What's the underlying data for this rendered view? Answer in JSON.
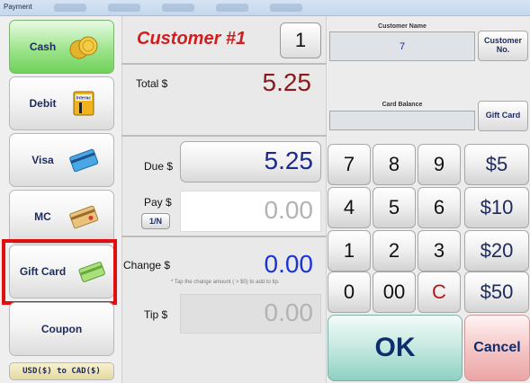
{
  "window": {
    "title": "Payment"
  },
  "payment_methods": {
    "cash": "Cash",
    "debit": "Debit",
    "debit_badge": "Interac",
    "visa": "Visa",
    "mc": "MC",
    "gift_card": "Gift Card",
    "coupon": "Coupon",
    "conversion": "USD($) to CAD($)"
  },
  "order": {
    "customer_title": "Customer #1",
    "customer_number": "1",
    "total_label": "Total $",
    "total_value": "5.25",
    "due_label": "Due $",
    "due_value": "5.25",
    "pay_label": "Pay $",
    "pay_value": "0.00",
    "one_n_button": "1/N",
    "change_label": "Change $",
    "change_value": "0.00",
    "change_note": "* Tap the change amount ( > $0) to add to tip.",
    "tip_label": "Tip $",
    "tip_value": "0.00"
  },
  "customer_panel": {
    "name_caption": "Customer Name",
    "name_value": "7",
    "customer_no_button": "Customer No.",
    "card_balance_caption": "Card Balance",
    "card_balance_value": "",
    "gift_card_button": "Gift Card"
  },
  "keypad": {
    "k7": "7",
    "k8": "8",
    "k9": "9",
    "q5": "$5",
    "k4": "4",
    "k5": "5",
    "k6": "6",
    "q10": "$10",
    "k1": "1",
    "k2": "2",
    "k3": "3",
    "q20": "$20",
    "k0": "0",
    "k00": "00",
    "clear": "C",
    "q50": "$50"
  },
  "actions": {
    "ok": "OK",
    "cancel": "Cancel"
  },
  "colors": {
    "customer_title": "#d11d1d",
    "total_value": "#8b1a1a",
    "amount_blue": "#1d2a8c",
    "change_blue": "#1a35d6",
    "placeholder_gray": "#b3b3b3",
    "highlight_red": "#e01010"
  }
}
